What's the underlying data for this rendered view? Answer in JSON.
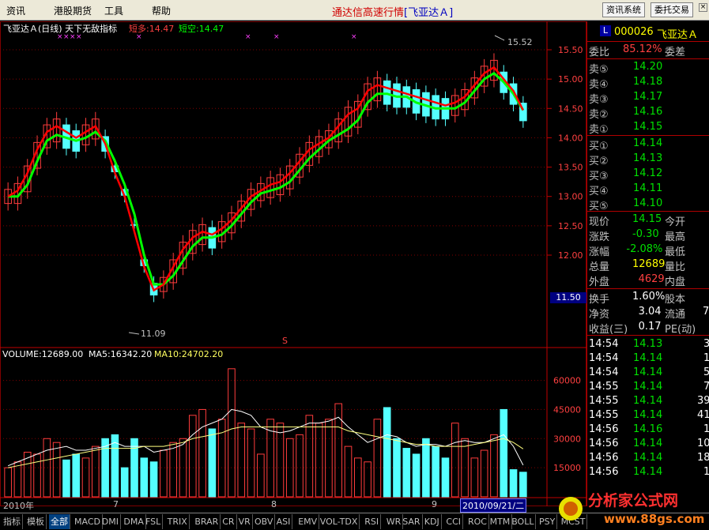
{
  "menu": [
    "资讯",
    "港股期货",
    "工具",
    "帮助"
  ],
  "app_title": "通达信高速行情",
  "app_code": "[飞亚达Ａ]",
  "toolbar": {
    "info_system": "资讯系统",
    "entrust": "委托交易"
  },
  "window_buttons": [
    "_",
    "□",
    "×"
  ],
  "chart": {
    "title_line": "飞亚达Ａ(日线) 天下无敌指标",
    "short_long_label": "短多:14.47",
    "short_short_label": "短空:14.47",
    "high_marker": "15.52",
    "low_marker": "11.09",
    "current_price_tag": "11.50",
    "volume_label": "VOLUME:12689.00",
    "ma5_label": "MA5:16342.20",
    "ma10_label": "MA10:24702.20",
    "s_marker": "S",
    "x_labels": [
      "2010年",
      "7",
      "8",
      "9"
    ],
    "date_tag": "2010/09/21/二",
    "colors": {
      "up": "#ff3c3c",
      "down": "#54ffff",
      "short_long": "#ff0000",
      "short_short": "#00ff00",
      "ma5": "#ffffff",
      "ma10": "#ffff80",
      "grid": "#800000"
    }
  },
  "chart_data": [
    {
      "type": "candlestick",
      "yticks": [
        "15.50",
        "15.00",
        "14.50",
        "14.00",
        "13.50",
        "13.00",
        "12.50",
        "12.00"
      ],
      "ylim": [
        10.6,
        15.85
      ],
      "series": [
        {
          "name": "短多",
          "values": [
            13.0,
            13.1,
            13.4,
            13.8,
            14.1,
            14.2,
            14.1,
            14.0,
            14.1,
            14.2,
            13.9,
            13.4,
            13.0,
            12.4,
            11.8,
            11.4,
            11.5,
            11.8,
            12.1,
            12.3,
            12.4,
            12.35,
            12.45,
            12.6,
            12.8,
            13.0,
            13.1,
            13.2,
            13.25,
            13.4,
            13.6,
            13.8,
            13.9,
            14.0,
            14.2,
            14.4,
            14.5,
            14.8,
            14.9,
            14.85,
            14.8,
            14.75,
            14.7,
            14.65,
            14.6,
            14.55,
            14.6,
            14.7,
            14.9,
            15.1,
            15.2,
            15.0,
            14.8,
            14.47
          ]
        },
        {
          "name": "短空",
          "values": [
            13.0,
            13.0,
            13.2,
            13.6,
            13.95,
            14.05,
            14.0,
            13.95,
            14.0,
            14.1,
            13.95,
            13.6,
            13.2,
            12.7,
            12.0,
            11.5,
            11.5,
            11.65,
            11.9,
            12.15,
            12.3,
            12.3,
            12.35,
            12.5,
            12.7,
            12.9,
            13.05,
            13.1,
            13.15,
            13.25,
            13.45,
            13.65,
            13.8,
            13.95,
            14.05,
            14.15,
            14.3,
            14.6,
            14.75,
            14.75,
            14.7,
            14.7,
            14.6,
            14.55,
            14.5,
            14.5,
            14.5,
            14.6,
            14.8,
            15.0,
            15.1,
            14.95,
            14.75,
            14.47
          ]
        }
      ]
    },
    {
      "type": "bar",
      "yticks": [
        "60000",
        "45000",
        "30000",
        "15000"
      ],
      "ylim": [
        0,
        70000
      ],
      "series": [
        {
          "name": "VOLUME",
          "values": [
            15000,
            18000,
            23000,
            22000,
            30000,
            28000,
            19000,
            22000,
            20000,
            26000,
            30000,
            32000,
            15000,
            30000,
            20000,
            18000,
            24000,
            28000,
            30000,
            42000,
            45000,
            35000,
            40000,
            66000,
            38000,
            35000,
            22000,
            40000,
            38000,
            30000,
            32000,
            42000,
            38000,
            40000,
            48000,
            26000,
            20000,
            18000,
            40000,
            46000,
            30000,
            25000,
            22000,
            30000,
            26000,
            20000,
            38000,
            30000,
            20000,
            24000,
            32000,
            45000,
            14000,
            12689
          ]
        },
        {
          "name": "MA5",
          "values": [
            16000,
            18000,
            20000,
            22000,
            24000,
            25000,
            26000,
            24000,
            24000,
            25000,
            26000,
            28000,
            26000,
            26000,
            26000,
            23000,
            24000,
            25000,
            27000,
            32000,
            36000,
            38000,
            40000,
            45000,
            44000,
            42000,
            36000,
            34000,
            33000,
            34000,
            36000,
            38000,
            38000,
            39000,
            41000,
            36000,
            32000,
            28000,
            30000,
            32000,
            31000,
            28000,
            26000,
            27000,
            27000,
            26000,
            28000,
            29000,
            28000,
            28000,
            30000,
            32000,
            26000,
            16342
          ]
        },
        {
          "name": "MA10",
          "values": [
            15000,
            16000,
            17000,
            18000,
            19000,
            20000,
            21000,
            22000,
            23000,
            24000,
            25000,
            25000,
            25000,
            25000,
            26000,
            26000,
            26000,
            27000,
            28000,
            30000,
            31000,
            32000,
            33000,
            35000,
            36000,
            36000,
            36000,
            36000,
            36000,
            36000,
            36000,
            36000,
            36000,
            36000,
            36000,
            34000,
            33000,
            32000,
            31000,
            30000,
            29000,
            28000,
            27000,
            27000,
            26000,
            26000,
            26000,
            26000,
            27000,
            28000,
            29000,
            30000,
            28000,
            24702
          ]
        }
      ]
    }
  ],
  "quote": {
    "stock_code": "000026",
    "stock_name": "飞亚达Ａ",
    "weibi_label": "委比",
    "weibi_value": "85.12%",
    "weicha_label": "委差",
    "sells": [
      {
        "label": "卖⑤",
        "price": "14.20"
      },
      {
        "label": "卖④",
        "price": "14.18"
      },
      {
        "label": "卖③",
        "price": "14.17"
      },
      {
        "label": "卖②",
        "price": "14.16"
      },
      {
        "label": "卖①",
        "price": "14.15"
      }
    ],
    "buys": [
      {
        "label": "买①",
        "price": "14.14"
      },
      {
        "label": "买②",
        "price": "14.13"
      },
      {
        "label": "买③",
        "price": "14.12"
      },
      {
        "label": "买④",
        "price": "14.11"
      },
      {
        "label": "买⑤",
        "price": "14.10"
      }
    ],
    "stats": [
      {
        "label": "现价",
        "value": "14.15",
        "label2": "今开",
        "cls": "green"
      },
      {
        "label": "涨跌",
        "value": "-0.30",
        "label2": "最高",
        "cls": "green"
      },
      {
        "label": "涨幅",
        "value": "-2.08%",
        "label2": "最低",
        "cls": "green"
      },
      {
        "label": "总量",
        "value": "12689",
        "label2": "量比",
        "cls": "yellow"
      },
      {
        "label": "外盘",
        "value": "4629",
        "label2": "内盘",
        "cls": "red"
      }
    ],
    "stats2": [
      {
        "label": "换手",
        "value": "1.60%",
        "label2": "股本"
      },
      {
        "label": "净资",
        "value": "3.04",
        "label2": "流通",
        "extra": "7"
      },
      {
        "label": "收益(三)",
        "value": "0.17",
        "label2": "PE(动)"
      }
    ],
    "ticks": [
      {
        "time": "14:54",
        "price": "14.13",
        "vol": "3"
      },
      {
        "time": "14:54",
        "price": "14.14",
        "vol": "1"
      },
      {
        "time": "14:54",
        "price": "14.14",
        "vol": "5"
      },
      {
        "time": "14:55",
        "price": "14.14",
        "vol": "7"
      },
      {
        "time": "14:55",
        "price": "14.14",
        "vol": "39"
      },
      {
        "time": "14:55",
        "price": "14.14",
        "vol": "41"
      },
      {
        "time": "14:56",
        "price": "14.16",
        "vol": "1"
      },
      {
        "time": "14:56",
        "price": "14.14",
        "vol": "10"
      },
      {
        "time": "14:56",
        "price": "14.14",
        "vol": "18"
      },
      {
        "time": "14:56",
        "price": "14.14",
        "vol": "1"
      }
    ]
  },
  "tabs": [
    "指标",
    "模板",
    "全部",
    "MACD",
    "DMI",
    "DMA",
    "FSL",
    "TRIX",
    "BRAR",
    "CR",
    "VR",
    "OBV",
    "ASI",
    "EMV",
    "VOL-TDX",
    "RSI",
    "WR",
    "SAR",
    "KDJ",
    "CCI",
    "ROC",
    "MTM",
    "BOLL",
    "PSY",
    "MCST"
  ],
  "watermark": {
    "title": "分析家公式网",
    "url": "www.88gs.com"
  }
}
